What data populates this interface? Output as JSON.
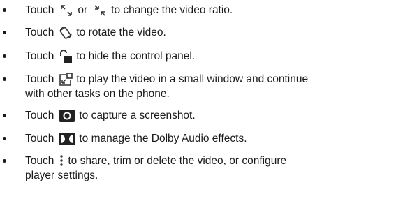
{
  "items": [
    {
      "lead": "Touch",
      "icons": [
        "ratio-shrink-icon",
        "ratio-expand-icon"
      ],
      "join": "or",
      "text": "to change the video ratio."
    },
    {
      "lead": "Touch",
      "icons": [
        "rotate-icon"
      ],
      "text": "to rotate the video."
    },
    {
      "lead": "Touch",
      "icons": [
        "unlock-icon"
      ],
      "text": "to hide the control panel."
    },
    {
      "lead": "Touch",
      "icons": [
        "picture-in-picture-icon"
      ],
      "text": "to play the video in a small window and continue",
      "text2": "with other tasks on the phone."
    },
    {
      "lead": "Touch",
      "icons": [
        "camera-icon"
      ],
      "text": "to capture a screenshot."
    },
    {
      "lead": "Touch",
      "icons": [
        "dolby-icon"
      ],
      "text": "to manage the Dolby Audio effects."
    },
    {
      "lead": "Touch",
      "icons": [
        "more-vertical-icon"
      ],
      "text": "to share, trim or delete the video, or configure",
      "text2": "player settings."
    }
  ]
}
